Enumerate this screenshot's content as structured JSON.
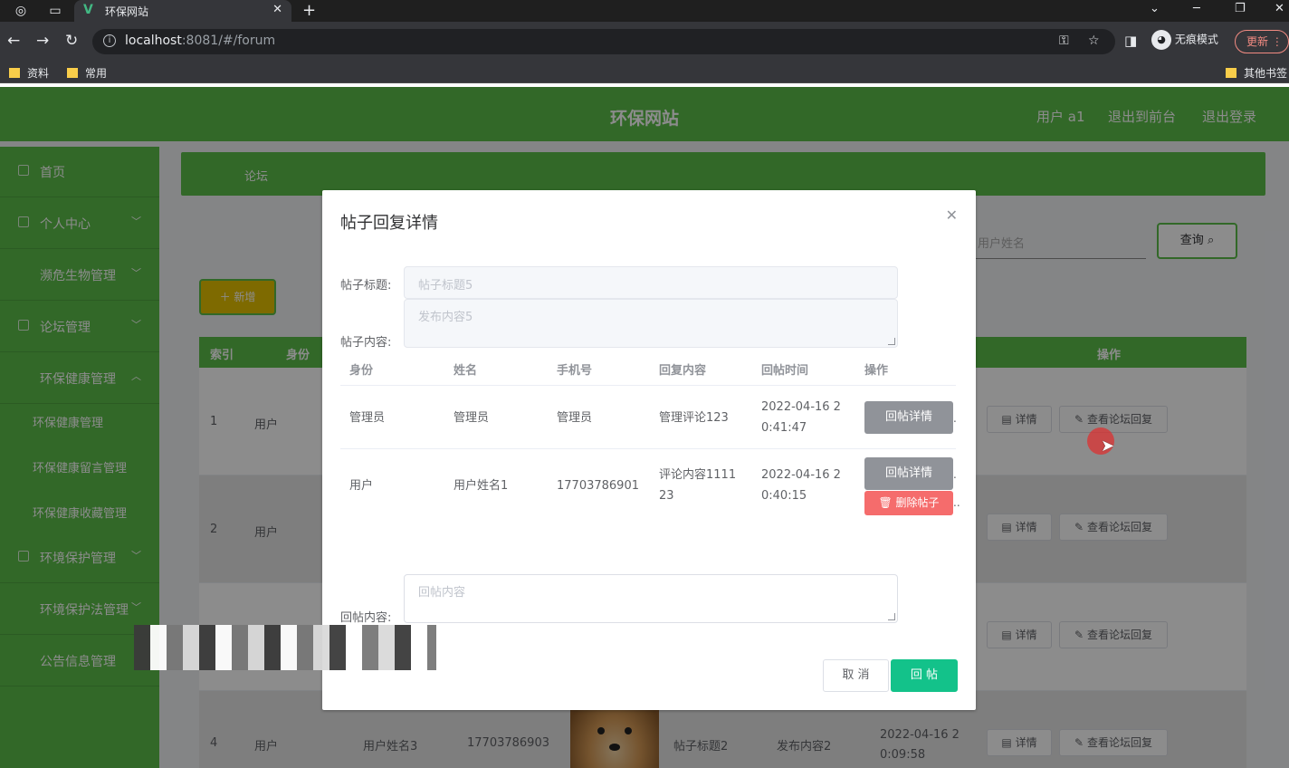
{
  "browser": {
    "tab_title": "环保网站",
    "url_host": "localhost",
    "url_path": ":8081/#/forum",
    "incognito_label": "无痕模式",
    "update_label": "更新",
    "bookmarks": [
      "资料",
      "常用"
    ],
    "other_bookmarks": "其他书签"
  },
  "app": {
    "title": "环保网站",
    "header_links": [
      "用户 a1",
      "退出到前台",
      "退出登录"
    ]
  },
  "sidebar": {
    "items": [
      {
        "label": "首页"
      },
      {
        "label": "个人中心"
      },
      {
        "label": "濒危生物管理"
      },
      {
        "label": "论坛管理"
      },
      {
        "label": "环保健康管理"
      },
      {
        "label": "环保健康管理"
      },
      {
        "label": "环保健康留言管理"
      },
      {
        "label": "环保健康收藏管理"
      },
      {
        "label": "环境保护管理"
      },
      {
        "label": "环境保护法管理"
      },
      {
        "label": "公告信息管理"
      }
    ]
  },
  "main": {
    "breadcrumb": "论坛",
    "search_placeholder": "用户姓名",
    "query_label": "查询",
    "add_label": "＋ 新增",
    "columns": {
      "index": "索引",
      "identity": "身份",
      "actions": "操作"
    },
    "rows": [
      {
        "index": "1",
        "identity": "用户"
      },
      {
        "index": "2",
        "identity": "用户"
      },
      {
        "index": "4",
        "identity": "用户",
        "name": "用户姓名3",
        "phone": "17703786903",
        "post_title": "帖子标题2",
        "content": "发布内容2",
        "time": "2022-04-16 2 0:09:58"
      }
    ],
    "row_actions": {
      "detail": "详情",
      "view_replies": "查看论坛回复"
    }
  },
  "dialog": {
    "title": "帖子回复详情",
    "post_title_label": "帖子标题:",
    "post_title_value": "帖子标题5",
    "post_content_label": "帖子内容:",
    "post_content_value": "发布内容5",
    "columns": [
      "身份",
      "姓名",
      "手机号",
      "回复内容",
      "回帖时间",
      "操作"
    ],
    "replies": [
      {
        "identity": "管理员",
        "name": "管理员",
        "phone": "管理员",
        "content": "管理评论123",
        "time_line1": "2022-04-16 2",
        "time_line2": "0:41:47"
      },
      {
        "identity": "用户",
        "name": "用户姓名1",
        "phone": "17703786901",
        "content_line1": "评论内容1111",
        "content_line2": "23",
        "time_line1": "2022-04-16 2",
        "time_line2": "0:40:15"
      }
    ],
    "detail_button": "回帖详情",
    "delete_button": "删除帖子",
    "reply_label": "回帖内容:",
    "reply_placeholder": "回帖内容",
    "cancel_label": "取 消",
    "submit_label": "回 帖"
  },
  "colors": {
    "brand_green": "#5bbd4a",
    "submit_green": "#13c28a",
    "danger": "#f56c6c",
    "info_gray": "#909399"
  }
}
